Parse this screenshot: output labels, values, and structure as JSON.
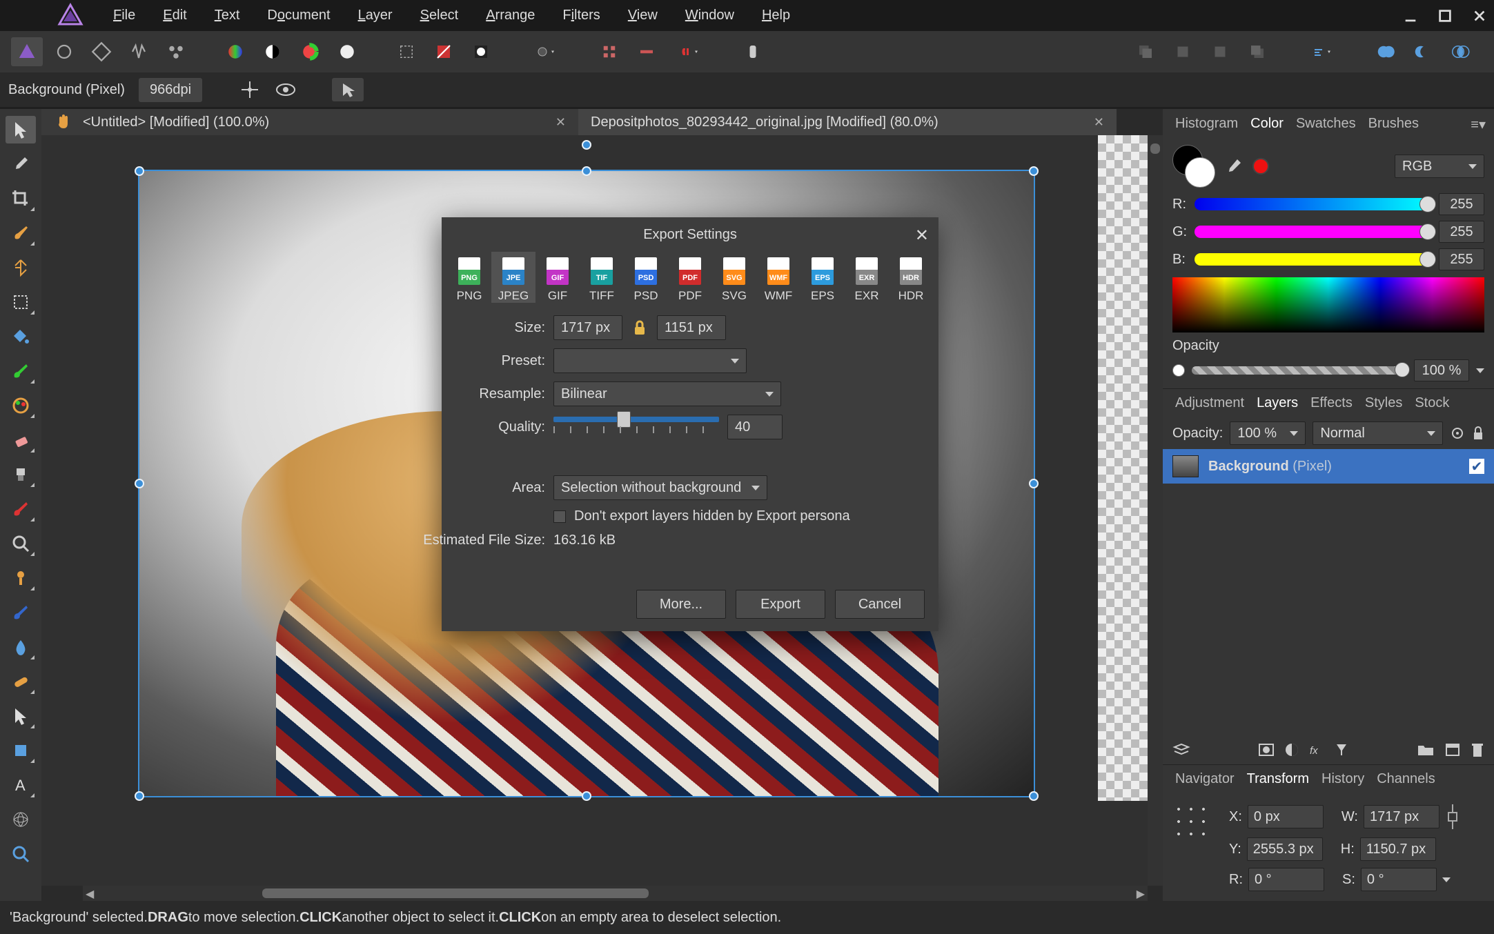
{
  "menu": {
    "file": "File",
    "edit": "Edit",
    "text": "Text",
    "document": "Document",
    "layer": "Layer",
    "select": "Select",
    "arrange": "Arrange",
    "filters": "Filters",
    "view": "View",
    "window": "Window",
    "help": "Help"
  },
  "context": {
    "layer_label": "Background (Pixel)",
    "dpi": "966dpi"
  },
  "tabs": [
    {
      "title": "<Untitled> [Modified] (100.0%)"
    },
    {
      "title": "Depositphotos_80293442_original.jpg [Modified] (80.0%)"
    }
  ],
  "color_panel": {
    "tabs": {
      "histogram": "Histogram",
      "color": "Color",
      "swatches": "Swatches",
      "brushes": "Brushes"
    },
    "model": "RGB",
    "r": "255",
    "g": "255",
    "b": "255",
    "opacity_label": "Opacity",
    "opacity": "100 %"
  },
  "layers_panel": {
    "tabs": {
      "adjustment": "Adjustment",
      "layers": "Layers",
      "effects": "Effects",
      "styles": "Styles",
      "stock": "Stock"
    },
    "opacity_label": "Opacity:",
    "opacity": "100 %",
    "blend": "Normal",
    "layer_name": "Background",
    "layer_kind": "(Pixel)"
  },
  "nav_panel": {
    "tabs": {
      "navigator": "Navigator",
      "transform": "Transform",
      "history": "History",
      "channels": "Channels"
    },
    "x_label": "X:",
    "x": "0 px",
    "w_label": "W:",
    "w": "1717 px",
    "y_label": "Y:",
    "y": "2555.3 px",
    "h_label": "H:",
    "h": "1150.7 px",
    "r_label": "R:",
    "r": "0 °",
    "s_label": "S:",
    "s": "0 °"
  },
  "dialog": {
    "title": "Export Settings",
    "formats": [
      "PNG",
      "JPEG",
      "GIF",
      "TIFF",
      "PSD",
      "PDF",
      "SVG",
      "WMF",
      "EPS",
      "EXR",
      "HDR"
    ],
    "format_colors": [
      "#3db15a",
      "#2b83c7",
      "#c334c6",
      "#19a0a0",
      "#2d6fe0",
      "#d12c2c",
      "#ff8c1a",
      "#ff8c1a",
      "#2d9bdd",
      "#888888",
      "#888888"
    ],
    "selected_format": 1,
    "size_label": "Size:",
    "w": "1717 px",
    "h": "1151 px",
    "preset_label": "Preset:",
    "preset": "",
    "resample_label": "Resample:",
    "resample": "Bilinear",
    "quality_label": "Quality:",
    "quality": "40",
    "area_label": "Area:",
    "area": "Selection without background",
    "hidden_label": "Don't export layers hidden by Export persona",
    "est_label": "Estimated File Size:",
    "est": "163.16 kB",
    "more": "More...",
    "export": "Export",
    "cancel": "Cancel"
  },
  "status": {
    "p1": "'Background' selected. ",
    "d1": "DRAG",
    "p2": " to move selection. ",
    "c1": "CLICK",
    "p3": " another object to select it. ",
    "c2": "CLICK",
    "p4": " on an empty area to deselect selection."
  }
}
